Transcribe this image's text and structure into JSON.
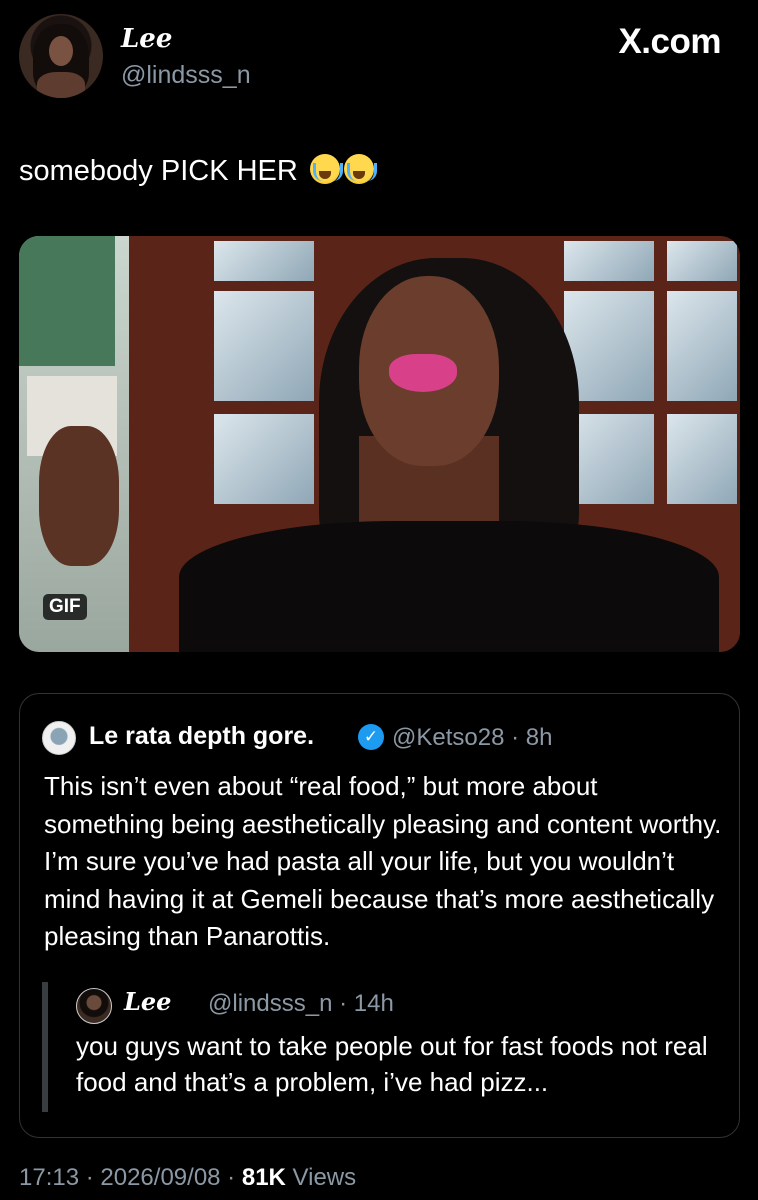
{
  "author": {
    "display_name": "Lee",
    "handle": "@lindsss_n"
  },
  "brand": "X.com",
  "tweet": {
    "text": "somebody PICK HER"
  },
  "media": {
    "badge": "GIF"
  },
  "quote": {
    "display_name": "Le rata depth gore.",
    "handle_time": "@Ketso28 · 8h",
    "text": "This isn’t even about “real food,” but more about something being aesthetically pleasing and content worthy. I’m sure you’ve had pasta all your life, but you wouldn’t mind having it at Gemeli because that’s more aesthetically pleasing than Panarottis.",
    "nested": {
      "display_name": "Lee",
      "handle_time": "@lindsss_n · 14h",
      "text": "you guys want to take people out for fast foods not real food and that’s a problem, i’ve had pizz..."
    }
  },
  "footer": {
    "time": "17:13",
    "date": "2026/09/08",
    "views_count": "81K",
    "views_label": "Views"
  },
  "colors": {
    "background": "#000000",
    "muted": "#8b98a5",
    "verified": "#1d9bf0"
  }
}
